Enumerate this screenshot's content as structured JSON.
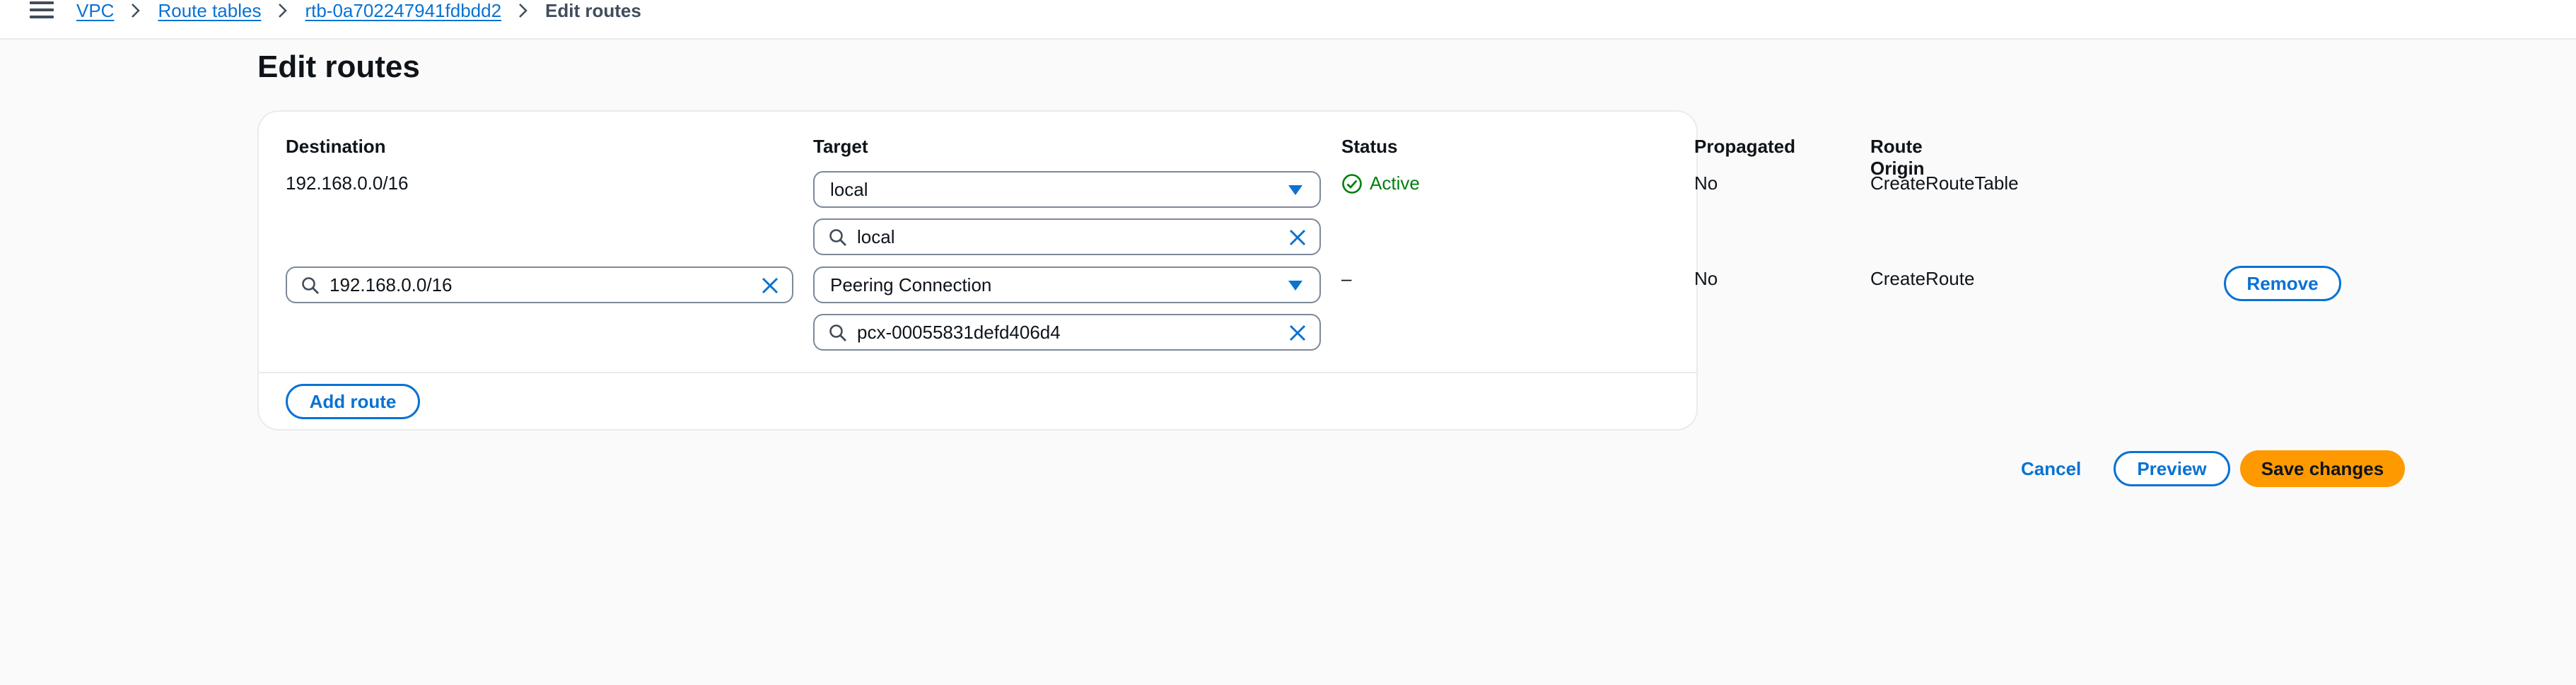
{
  "breadcrumb": {
    "items": [
      "VPC",
      "Route tables",
      "rtb-0a702247941fdbdd2"
    ],
    "current": "Edit routes"
  },
  "page": {
    "title": "Edit routes"
  },
  "table": {
    "headers": {
      "destination": "Destination",
      "target": "Target",
      "status": "Status",
      "propagated": "Propagated",
      "route_origin": "Route Origin"
    },
    "rows": [
      {
        "destination": "192.168.0.0/16",
        "target_type": "local",
        "target_value": "local",
        "status": "Active",
        "propagated": "No",
        "route_origin": "CreateRouteTable"
      },
      {
        "destination": "192.168.0.0/16",
        "target_type": "Peering Connection",
        "target_value": "pcx-00055831defd406d4",
        "status": "–",
        "propagated": "No",
        "route_origin": "CreateRoute",
        "remove_label": "Remove"
      }
    ]
  },
  "actions": {
    "add_route": "Add route",
    "cancel": "Cancel",
    "preview": "Preview",
    "save": "Save changes"
  },
  "colors": {
    "link": "#0972d3",
    "success": "#037f0c",
    "primary_button": "#ff9900",
    "border": "#7d8998"
  },
  "icons": [
    "menu-icon",
    "chevron-right-icon",
    "search-icon",
    "clear-icon",
    "caret-down-icon",
    "status-check-icon"
  ]
}
